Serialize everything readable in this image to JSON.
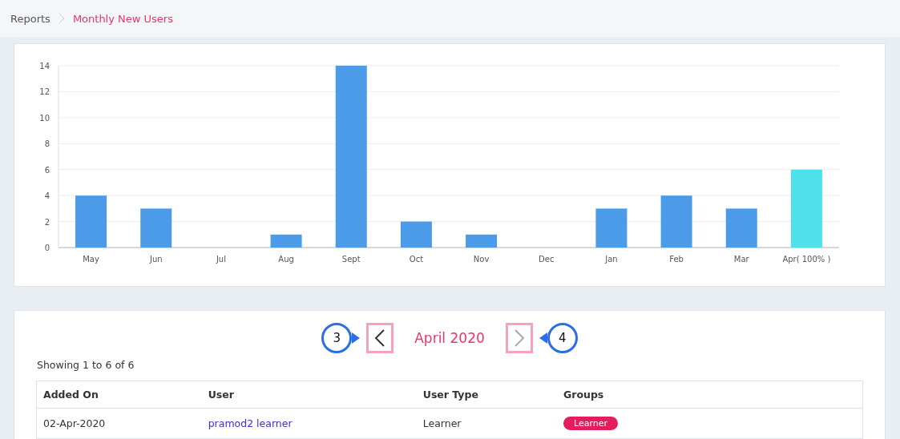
{
  "breadcrumb": [
    {
      "label": "Reports",
      "selected": false
    },
    {
      "label": "Monthly New Users",
      "selected": true
    }
  ],
  "chart": {
    "chart_data": {
      "type": "bar",
      "grid": true,
      "categories": [
        "May",
        "Jun",
        "Jul",
        "Aug",
        "Sept",
        "Oct",
        "Nov",
        "Dec",
        "Jan",
        "Feb",
        "Mar",
        "Apr( 100% )"
      ],
      "series": [
        {
          "color": "#4c9be8",
          "values": [
            4,
            3,
            0,
            1,
            14,
            2,
            1,
            0,
            3,
            4,
            3,
            null
          ]
        },
        {
          "color": "#4ee1ec",
          "values": [
            null,
            null,
            null,
            null,
            null,
            null,
            null,
            null,
            null,
            null,
            null,
            6
          ]
        }
      ],
      "ylim": [
        0,
        14
      ],
      "yticks": [
        0,
        2,
        4,
        6,
        8,
        10,
        12,
        14
      ]
    }
  },
  "pager": {
    "prev": {
      "disabled": false,
      "callout": "3"
    },
    "title": "April 2020",
    "next": {
      "disabled": true,
      "callout": "4"
    }
  },
  "summary": "Showing 1 to 6 of 6",
  "table": {
    "columns": [
      "Added On",
      "User",
      "User Type",
      "Groups"
    ],
    "rows": [
      {
        "added_on": "02-Apr-2020",
        "user": "pramod2 learner",
        "user_type": "Learner",
        "groups": [
          "Learner"
        ]
      }
    ]
  }
}
